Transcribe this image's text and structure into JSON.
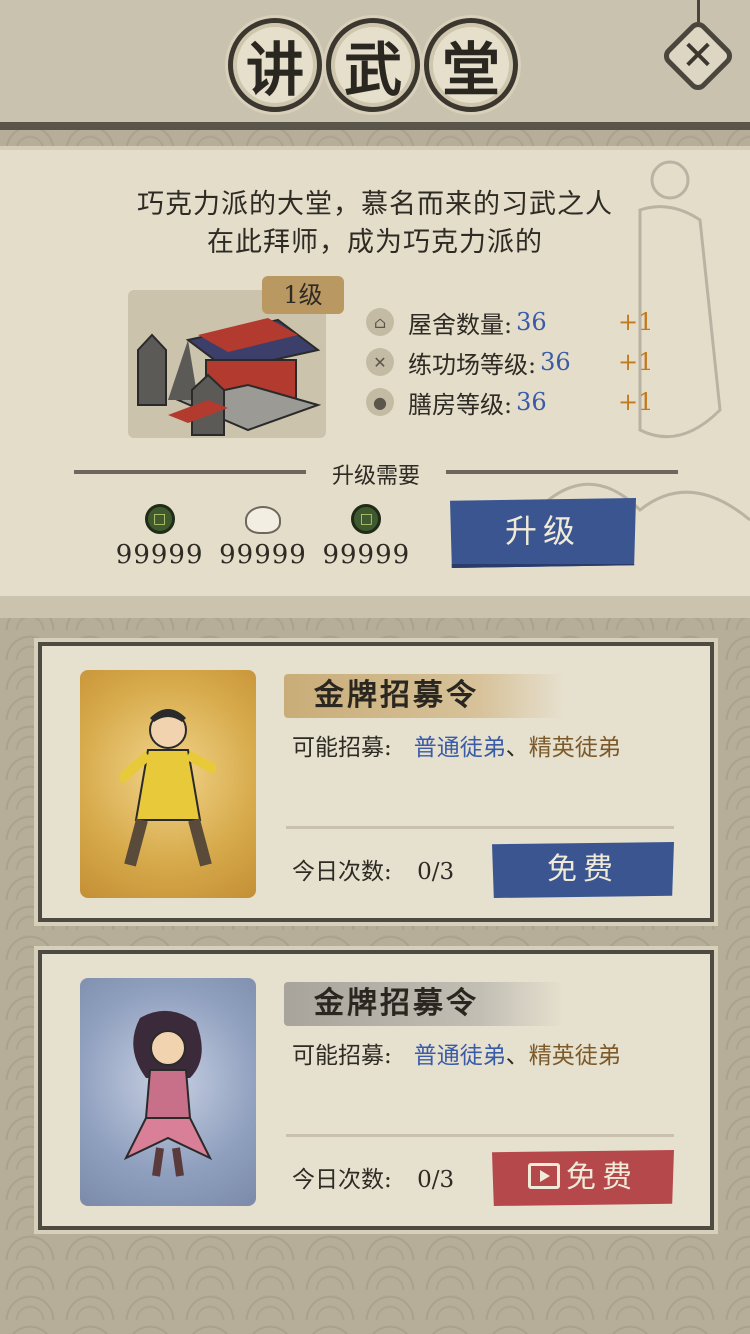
{
  "header": {
    "title_chars": [
      "讲",
      "武",
      "堂"
    ],
    "close_symbol": "✕"
  },
  "hall": {
    "description_line1": "巧克力派的大堂，慕名而来的习武之人",
    "description_line2": "在此拜师，成为巧克力派的",
    "level_badge": "1级",
    "stats": [
      {
        "icon": "house-icon",
        "label": "屋舍数量:",
        "value": "36",
        "plus": "+1"
      },
      {
        "icon": "sword-icon",
        "label": "练功场等级:",
        "value": "36",
        "plus": "+1"
      },
      {
        "icon": "food-icon",
        "label": "膳房等级:",
        "value": "36",
        "plus": "+1"
      }
    ],
    "requirement_label": "升级需要",
    "costs": [
      {
        "icon": "copper-coin-icon",
        "value": "99999"
      },
      {
        "icon": "steamed-bun-icon",
        "value": "99999"
      },
      {
        "icon": "copper-coin-icon",
        "value": "99999"
      }
    ],
    "upgrade_label": "升级"
  },
  "cards": [
    {
      "title": "金牌招募令",
      "possible_label": "可能招募:",
      "possible_normal": "普通徒弟",
      "separator": "、",
      "possible_elite": "精英徒弟",
      "today_label": "今日次数:",
      "today_value": "0/3",
      "button_label": "免费",
      "button_color": "#3b5590"
    },
    {
      "title": "金牌招募令",
      "possible_label": "可能招募:",
      "possible_normal": "普通徒弟",
      "separator": "、",
      "possible_elite": "精英徒弟",
      "today_label": "今日次数:",
      "today_value": "0/3",
      "button_label": "免费",
      "button_color": "#b5484a"
    }
  ],
  "colors": {
    "accent_blue": "#3a5ba8",
    "plus_orange": "#c27a1e",
    "button_blue": "#3b5590",
    "button_red": "#b5484a"
  }
}
